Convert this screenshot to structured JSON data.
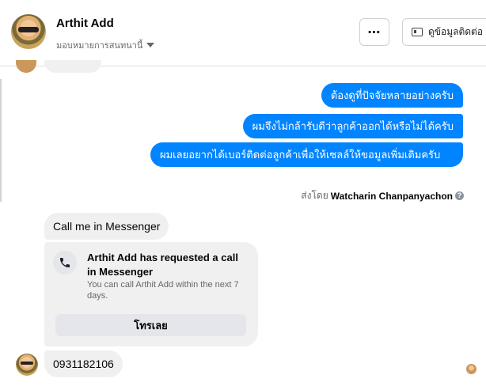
{
  "header": {
    "contact_name": "Arthit Add",
    "subtitle": "มอบหมายการสนทนานี้",
    "more_button": "⋯",
    "profile_button": "ดูข้อมูลติดต่อ"
  },
  "messages_out": [
    "ต้องดูที่ปัจจัยหลายอย่างครับ",
    "ผมจึงไม่กล้ารับดีว่าลูกค้าออกได้หรือไม่ได้ครับ",
    "ผมเลยอยากได้เบอร์ติดต่อลูกค้าเพื่อให้เซลล์ให้ขอมูลเพิ่มเติมครับ"
  ],
  "sent_by": {
    "prefix": "ส่งโดย",
    "name": "Watcharin Chanpanyachon",
    "help": "?"
  },
  "messages_in": [
    "Call me in Messenger",
    "0931182106"
  ],
  "call_card": {
    "title": "Arthit Add has requested a call in Messenger",
    "description": "You can call Arthit Add within the next 7 days.",
    "button": "โทรเลย"
  },
  "colors": {
    "outgoing_bubble": "#0084ff",
    "incoming_bubble": "#f0f0f0"
  }
}
